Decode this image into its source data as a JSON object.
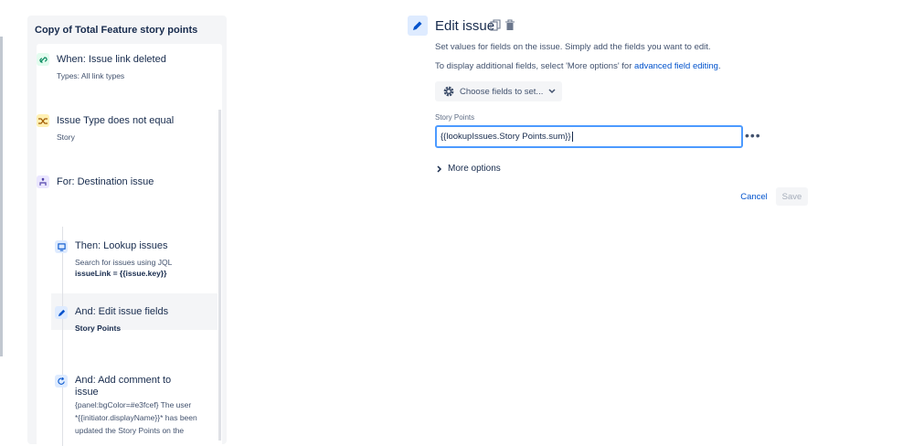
{
  "rule": {
    "title": "Copy of Total Feature story points",
    "steps": [
      {
        "title": "When: Issue link deleted",
        "lines": [
          "Types: All link types"
        ],
        "icon": "link-broken-icon"
      },
      {
        "title": "Issue Type does not equal",
        "lines": [
          "Story"
        ],
        "icon": "condition-icon"
      },
      {
        "title": "For: Destination issue",
        "lines": [],
        "icon": "branch-icon"
      },
      {
        "title": "Then: Lookup issues",
        "lines": [
          "Search for issues using JQL"
        ],
        "bold_line": "issueLink = {{issue.key}}",
        "icon": "lookup-icon"
      },
      {
        "title": "And: Edit issue fields",
        "bold_line": "Story Points",
        "icon": "pencil-icon"
      },
      {
        "title": "And: Add comment to",
        "title2": "issue",
        "lines": [
          "{panel:bgColor=#e3fcef} The user",
          "*{{initiator.displayName}}* has been",
          "updated the Story Points on the"
        ],
        "icon": "comment-icon"
      }
    ]
  },
  "editor": {
    "title": "Edit issue",
    "description": "Set values for fields on the issue. Simply add the fields you want to edit.",
    "additional_prefix": "To display additional fields, select 'More options' for ",
    "additional_link": "advanced field editing",
    "additional_suffix": ".",
    "choose_fields_label": "Choose fields to set...",
    "field_label": "Story Points",
    "field_value": "{{lookupIssues.Story Points.sum}}",
    "more_options_label": "More options",
    "cancel_label": "Cancel",
    "save_label": "Save"
  },
  "colors": {
    "accent": "#0052cc",
    "focus_border": "#4c9aff"
  }
}
